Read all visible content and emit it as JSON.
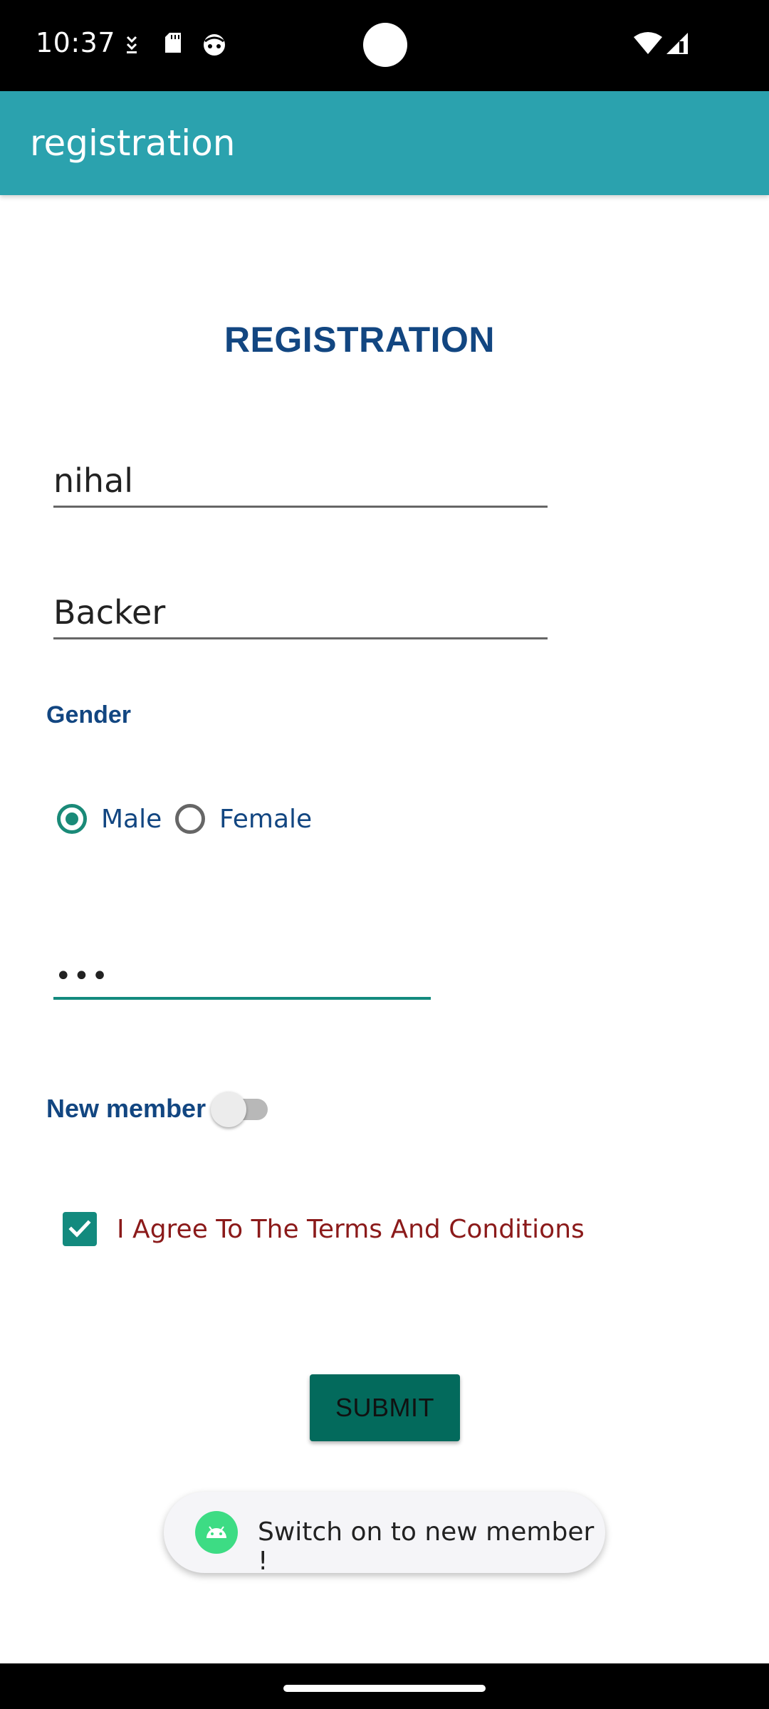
{
  "status_bar": {
    "time": "10:37",
    "icons": [
      "download-icon",
      "sd-card-icon",
      "face-icon",
      "wifi-icon",
      "signal-icon"
    ]
  },
  "app_bar": {
    "title": "registration"
  },
  "form": {
    "heading": "REGISTRATION",
    "first_name_value": "nihal",
    "last_name_value": "Backer",
    "gender_label": "Gender",
    "gender_options": [
      {
        "label": "Male",
        "selected": true
      },
      {
        "label": "Female",
        "selected": false
      }
    ],
    "password_value": "•••",
    "new_member_label": "New member",
    "new_member_on": false,
    "terms_label": "I Agree To The Terms And Conditions",
    "terms_checked": true,
    "submit_label": "SUBMIT"
  },
  "toast": {
    "text": "Switch on to new member !"
  },
  "colors": {
    "app_bar": "#2ba2ae",
    "heading": "#124681",
    "accent": "#138a7e",
    "submit": "#036a5c",
    "terms_text": "#8b1a1a"
  }
}
